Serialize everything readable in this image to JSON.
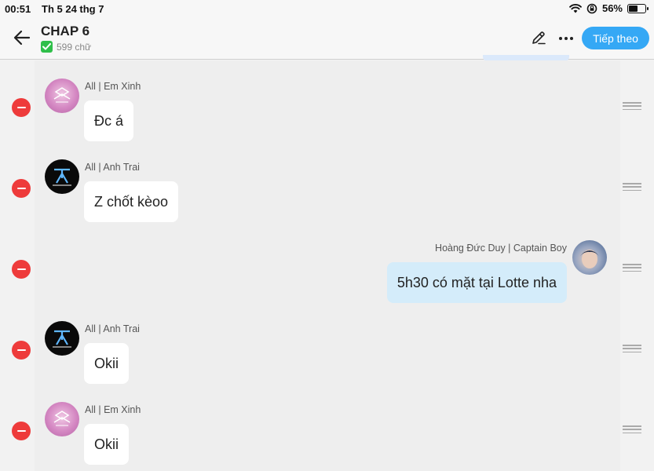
{
  "status_bar": {
    "time": "00:51",
    "date": "Th 5 24 thg 7",
    "battery": "56%",
    "battery_level": 0.56
  },
  "header": {
    "title": "CHAP 6",
    "word_count": "599 chữ",
    "next_label": "Tiếp theo",
    "accent_color": "#35a8f5"
  },
  "messages": [
    {
      "sender": "All | Em Xinh",
      "text": "Đc á",
      "avatar": "em-xinh-avatar",
      "side": "left"
    },
    {
      "sender": "All | Anh Trai",
      "text": "Z chốt kèoo",
      "avatar": "anh-trai-avatar",
      "side": "left"
    },
    {
      "sender": "Hoàng Đức Duy | Captain Boy",
      "text": "5h30 có mặt tại Lotte nha",
      "avatar": "captain-boy-avatar",
      "side": "right"
    },
    {
      "sender": "All | Anh Trai",
      "text": "Okii",
      "avatar": "anh-trai-avatar",
      "side": "left"
    },
    {
      "sender": "All | Em Xinh",
      "text": "Okii",
      "avatar": "em-xinh-avatar",
      "side": "left"
    }
  ]
}
